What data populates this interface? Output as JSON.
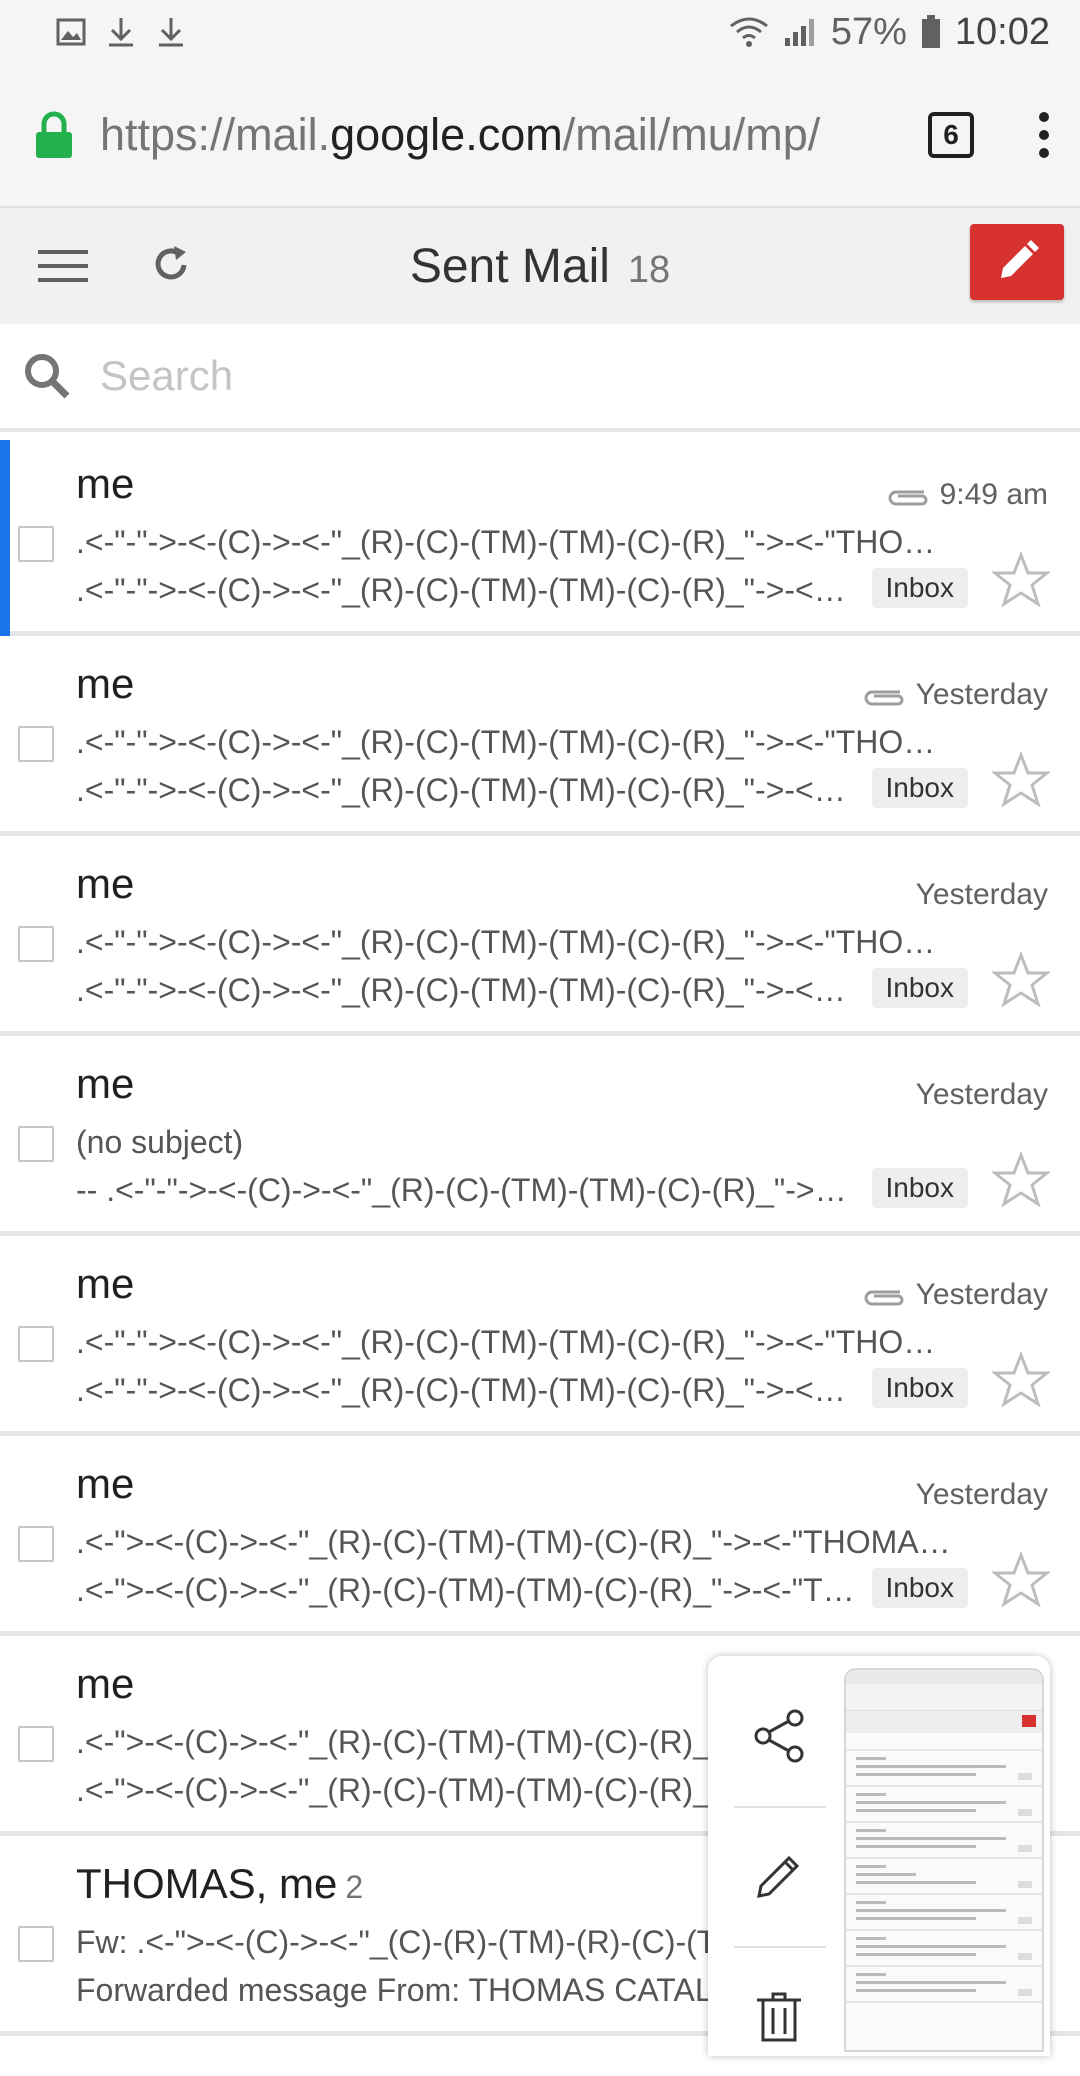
{
  "status_bar": {
    "battery": "57%",
    "time": "10:02"
  },
  "url_bar": {
    "url_prefix": "https://mail.",
    "url_domain": "google.com",
    "url_suffix": "/mail/mu/mp/",
    "tab_count": "6"
  },
  "toolbar": {
    "title": "Sent Mail",
    "count": "18"
  },
  "search": {
    "placeholder": "Search"
  },
  "emails": [
    {
      "sender": "me",
      "count": "",
      "time": "9:49 am",
      "attachment": true,
      "subject": ".<-\"-\"->-<-(C)->-<-\"_(R)-(C)-(TM)-(TM)-(C)-(R)_\"->-<-\"THOMAS CATALANO\"",
      "snippet": ".<-\"-\"->-<-(C)->-<-\"_(R)-(C)-(TM)-(TM)-(C)-(R)_\"->-<-\"THOMAS\"",
      "label": "Inbox"
    },
    {
      "sender": "me",
      "count": "",
      "time": "Yesterday",
      "attachment": true,
      "subject": ".<-\"-\"->-<-(C)->-<-\"_(R)-(C)-(TM)-(TM)-(C)-(R)_\"->-<-\"THOMAS CATALANO\"",
      "snippet": ".<-\"-\"->-<-(C)->-<-\"_(R)-(C)-(TM)-(TM)-(C)-(R)_\"->-<-\"THOMAS\"",
      "label": "Inbox"
    },
    {
      "sender": "me",
      "count": "",
      "time": "Yesterday",
      "attachment": false,
      "subject": ".<-\"-\"->-<-(C)->-<-\"_(R)-(C)-(TM)-(TM)-(C)-(R)_\"->-<-\"THOMAS CATALANO\"",
      "snippet": ".<-\"-\"->-<-(C)->-<-\"_(R)-(C)-(TM)-(TM)-(C)-(R)_\"->-<-\"THOMAS\"",
      "label": "Inbox"
    },
    {
      "sender": "me",
      "count": "",
      "time": "Yesterday",
      "attachment": false,
      "subject": "(no subject)",
      "snippet": "-- .<-\"-\"->-<-(C)->-<-\"_(R)-(C)-(TM)-(TM)-(C)-(R)_\"->-<-\"THOMAS\"",
      "label": "Inbox"
    },
    {
      "sender": "me",
      "count": "",
      "time": "Yesterday",
      "attachment": true,
      "subject": ".<-\"-\"->-<-(C)->-<-\"_(R)-(C)-(TM)-(TM)-(C)-(R)_\"->-<-\"THOMAS CATALANO\"",
      "snippet": ".<-\"-\"->-<-(C)->-<-\"_(R)-(C)-(TM)-(TM)-(C)-(R)_\"->-<-\"THOMAS\"",
      "label": "Inbox"
    },
    {
      "sender": "me",
      "count": "",
      "time": "Yesterday",
      "attachment": false,
      "subject": ".<-\">-<-(C)->-<-\"_(R)-(C)-(TM)-(TM)-(C)-(R)_\"->-<-\"THOMAS CATALANO\"",
      "snippet": ".<-\">-<-(C)->-<-\"_(R)-(C)-(TM)-(TM)-(C)-(R)_\"->-<-\"THOMAS\"",
      "label": "Inbox"
    },
    {
      "sender": "me",
      "count": "",
      "time": "",
      "attachment": false,
      "subject": ".<-\">-<-(C)->-<-\"_(R)-(C)-(TM)-(TM)-(C)-(R)_\"->-<-\"THOMAS CATALANO\"",
      "snippet": ".<-\">-<-(C)->-<-\"_(R)-(C)-(TM)-(TM)-(C)-(R)_\"->-<-\"THOMAS\"",
      "label": ""
    },
    {
      "sender": "THOMAS, me",
      "count": "2",
      "time": "",
      "attachment": false,
      "subject": "Fw: .<-\">-<-(C)->-<-\"_(C)-(R)-(TM)-(R)-(C)-(TM)",
      "snippet": "Forwarded message From: THOMAS CATALANO",
      "label": ""
    }
  ],
  "colors": {
    "compose": "#d7322f",
    "selected_bar": "#1a73e8",
    "lock": "#22b14c"
  }
}
